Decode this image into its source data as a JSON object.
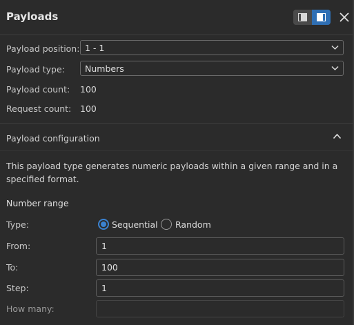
{
  "panel": {
    "title": "Payloads"
  },
  "payload_position": {
    "label": "Payload position:",
    "value": "1 - 1"
  },
  "payload_type": {
    "label": "Payload type:",
    "value": "Numbers"
  },
  "payload_count": {
    "label": "Payload count:",
    "value": "100"
  },
  "request_count": {
    "label": "Request count:",
    "value": "100"
  },
  "config": {
    "title": "Payload configuration",
    "description": "This payload type generates numeric payloads within a given range and in a specified format.",
    "number_range": {
      "heading": "Number range",
      "type_label": "Type:",
      "options": [
        {
          "label": "Sequential",
          "selected": true
        },
        {
          "label": "Random",
          "selected": false
        }
      ],
      "from": {
        "label": "From:",
        "value": "1"
      },
      "to": {
        "label": "To:",
        "value": "100"
      },
      "step": {
        "label": "Step:",
        "value": "1"
      },
      "how_many": {
        "label": "How many:",
        "value": ""
      }
    }
  },
  "colors": {
    "background": "#2b2b2b",
    "accent": "#3b82d0",
    "toggle_active": "#2f6fb4"
  }
}
